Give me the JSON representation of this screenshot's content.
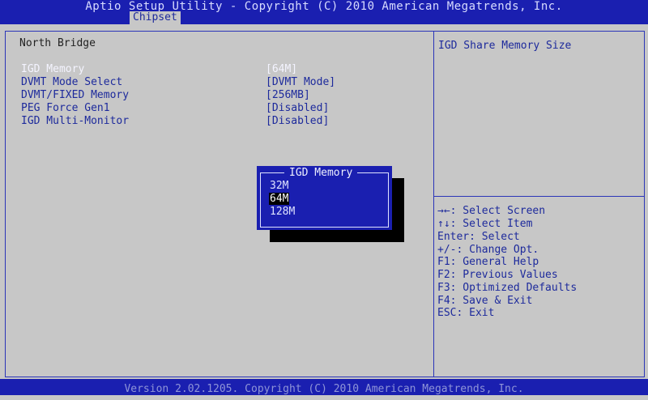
{
  "header": {
    "title": "Aptio Setup Utility - Copyright (C) 2010 American Megatrends, Inc.",
    "tab": "Chipset"
  },
  "main": {
    "section_title": "North Bridge",
    "items": [
      {
        "label": "IGD Memory",
        "value": "[64M]"
      },
      {
        "label": "DVMT Mode Select",
        "value": "[DVMT Mode]"
      },
      {
        "label": "DVMT/FIXED Memory",
        "value": "[256MB]"
      },
      {
        "label": "PEG Force Gen1",
        "value": "[Disabled]"
      },
      {
        "label": "IGD Multi-Monitor",
        "value": "[Disabled]"
      }
    ]
  },
  "help": {
    "description": "IGD Share Memory Size",
    "keys": [
      "→←: Select Screen",
      "↑↓: Select Item",
      "Enter: Select",
      "+/-: Change Opt.",
      "F1: General Help",
      "F2: Previous Values",
      "F3: Optimized Defaults",
      "F4: Save & Exit",
      "ESC: Exit"
    ]
  },
  "popup": {
    "title": "IGD Memory",
    "options": [
      "32M",
      "64M",
      "128M"
    ],
    "selected": "64M"
  },
  "footer": {
    "text": "Version 2.02.1205. Copyright (C) 2010 American Megatrends, Inc."
  },
  "colors": {
    "bios_blue": "#1a1fb0",
    "background_gray": "#c7c7c7",
    "text_blue": "#1d2a9c"
  }
}
